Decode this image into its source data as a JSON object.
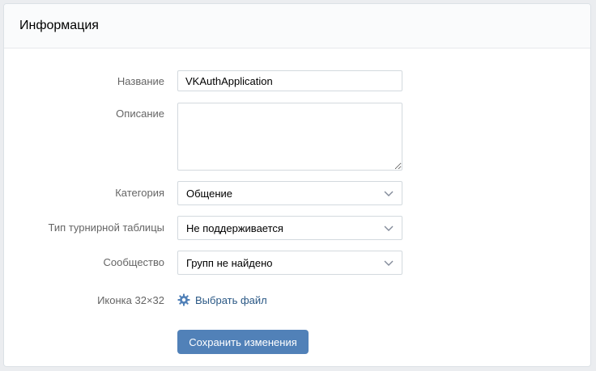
{
  "header": {
    "title": "Информация"
  },
  "form": {
    "name": {
      "label": "Название",
      "value": "VKAuthApplication"
    },
    "description": {
      "label": "Описание",
      "value": ""
    },
    "category": {
      "label": "Категория",
      "value": "Общение"
    },
    "leaderboard": {
      "label": "Тип турнирной таблицы",
      "value": "Не поддерживается"
    },
    "community": {
      "label": "Сообщество",
      "value": "Групп не найдено"
    },
    "icon": {
      "label": "Иконка 32×32",
      "link_text": "Выбрать файл",
      "icon_name": "gear-icon"
    },
    "save_label": "Сохранить изменения"
  },
  "colors": {
    "accent": "#5181b8",
    "link": "#2a5885",
    "label": "#656565",
    "background": "#ebedf0"
  }
}
